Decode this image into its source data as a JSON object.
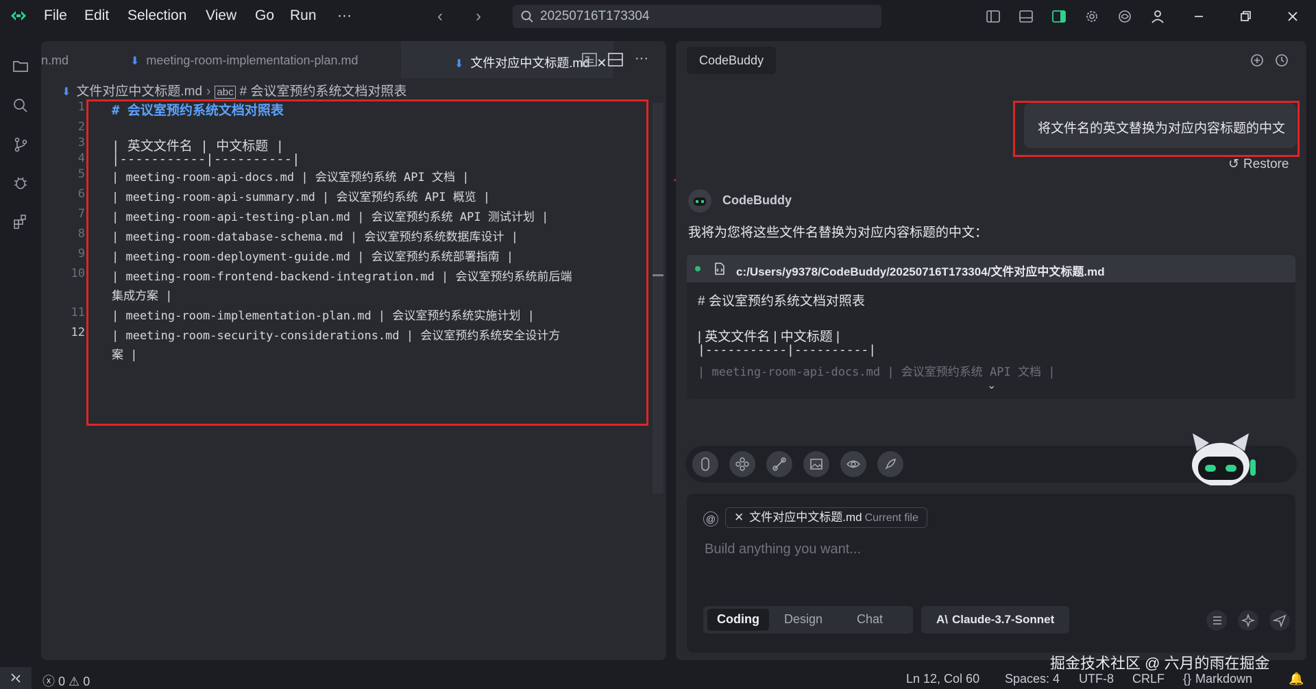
{
  "titlebar": {
    "menu": [
      "File",
      "Edit",
      "Selection",
      "View",
      "Go",
      "Run",
      "···"
    ],
    "search": "20250716T173304"
  },
  "editor": {
    "tabs": [
      {
        "label": "n.md"
      },
      {
        "label": "meeting-room-implementation-plan.md"
      },
      {
        "label": "文件对应中文标题.md",
        "close": "✕"
      }
    ],
    "breadcrumb": {
      "file": "文件对应中文标题.md",
      "symbol": "# 会议室预约系统文档对照表"
    },
    "lines": [
      {
        "n": "1",
        "text": "# 会议室预约系统文档对照表"
      },
      {
        "n": "2",
        "text": ""
      },
      {
        "n": "3",
        "text": "| 英文文件名 | 中文标题 |"
      },
      {
        "n": "4",
        "text": "|-----------|----------|"
      },
      {
        "n": "5",
        "text": "| meeting-room-api-docs.md | 会议室预约系统 API 文档 |"
      },
      {
        "n": "6",
        "text": "| meeting-room-api-summary.md | 会议室预约系统 API 概览 |"
      },
      {
        "n": "7",
        "text": "| meeting-room-api-testing-plan.md | 会议室预约系统 API 测试计划 |"
      },
      {
        "n": "8",
        "text": "| meeting-room-database-schema.md | 会议室预约系统数据库设计 |"
      },
      {
        "n": "9",
        "text": "| meeting-room-deployment-guide.md | 会议室预约系统部署指南 |"
      },
      {
        "n": "10",
        "text": "| meeting-room-frontend-backend-integration.md | 会议室预约系统前后端",
        "wrap": "集成方案 |"
      },
      {
        "n": "11",
        "text": "| meeting-room-implementation-plan.md | 会议室预约系统实施计划 |"
      },
      {
        "n": "12",
        "text": "| meeting-room-security-considerations.md | 会议室预约系统安全设计方",
        "wrap": "案 |"
      }
    ]
  },
  "codebuddy": {
    "tab": "CodeBuddy",
    "user_message": "将文件名的英文替换为对应内容标题的中文",
    "restore": "Restore",
    "assistant_name": "CodeBuddy",
    "assistant_text": "我将为您将这些文件名替换为对应内容标题的中文：",
    "file_path": "c:/Users/y9378/CodeBuddy/20250716T173304/文件对应中文标题.md",
    "preview_lines": [
      "# 会议室预约系统文档对照表",
      "| 英文文件名 | 中文标题 |",
      "|-----------|----------|",
      "| meeting-room-api-docs.md | 会议室预约系统 API 文档 |"
    ],
    "context_chip": {
      "file": "文件对应中文标题.md",
      "sub": "Current file"
    },
    "placeholder": "Build anything you want...",
    "modes": [
      "Coding",
      "Design",
      "Chat"
    ],
    "model": "Claude-3.7-Sonnet"
  },
  "statusbar": {
    "problems": "0",
    "warnings": "0",
    "position": "Ln 12, Col 60",
    "spaces": "Spaces: 4",
    "encoding": "UTF-8",
    "eol": "CRLF",
    "language": "Markdown"
  },
  "watermark": "掘金技术社区 @ 六月的雨在掘金",
  "colors": {
    "accent": "#4a8ff5",
    "annotation": "#e02424",
    "heading": "#5aa2ff"
  }
}
